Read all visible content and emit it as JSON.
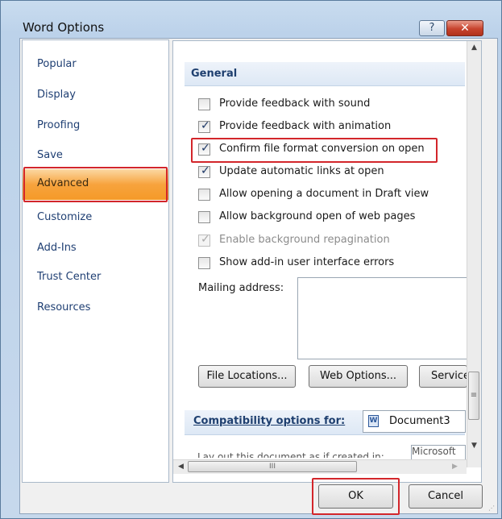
{
  "window": {
    "title": "Word Options",
    "help_label": "?",
    "close_label": "✕"
  },
  "sidebar": {
    "items": [
      {
        "label": "Popular"
      },
      {
        "label": "Display"
      },
      {
        "label": "Proofing"
      },
      {
        "label": "Save"
      },
      {
        "label": "Advanced",
        "selected": true
      },
      {
        "label": "Customize"
      },
      {
        "label": "Add-Ins"
      },
      {
        "label": "Trust Center"
      },
      {
        "label": "Resources"
      }
    ]
  },
  "general": {
    "heading": "General",
    "options": [
      {
        "label": "Provide feedback with sound",
        "checked": false,
        "enabled": true
      },
      {
        "label": "Provide feedback with animation",
        "checked": true,
        "enabled": true
      },
      {
        "label": "Confirm file format conversion on open",
        "checked": true,
        "enabled": true,
        "highlighted": true
      },
      {
        "label": "Update automatic links at open",
        "checked": true,
        "enabled": true
      },
      {
        "label": "Allow opening a document in Draft view",
        "checked": false,
        "enabled": true
      },
      {
        "label": "Allow background open of web pages",
        "checked": false,
        "enabled": true
      },
      {
        "label": "Enable background repagination",
        "checked": true,
        "enabled": false
      },
      {
        "label": "Show add-in user interface errors",
        "checked": false,
        "enabled": true
      }
    ],
    "mailing_address_label": "Mailing address:",
    "mailing_address_value": "",
    "buttons": {
      "file_locations": "File Locations...",
      "web_options": "Web Options...",
      "service": "Service"
    }
  },
  "compatibility": {
    "label": "Compatibility options for:",
    "document": "Document3",
    "layout_text": "Lay out this document as if created in:",
    "layout_value": "Microsoft"
  },
  "footer": {
    "ok_label": "OK",
    "cancel_label": "Cancel"
  },
  "icons": {
    "checkmark": "check-icon",
    "word_document": "word-document-icon",
    "scroll_up": "arrow-up-icon",
    "scroll_down": "arrow-down-icon",
    "scroll_left": "arrow-left-icon",
    "scroll_right": "arrow-right-icon",
    "resize": "resize-grip-icon"
  },
  "colors": {
    "selected_nav": "#f7a33d",
    "nav_text": "#1f3f73",
    "section_text": "#1e3f6f",
    "highlight_border": "#d3262b",
    "close_button": "#c7432d"
  }
}
